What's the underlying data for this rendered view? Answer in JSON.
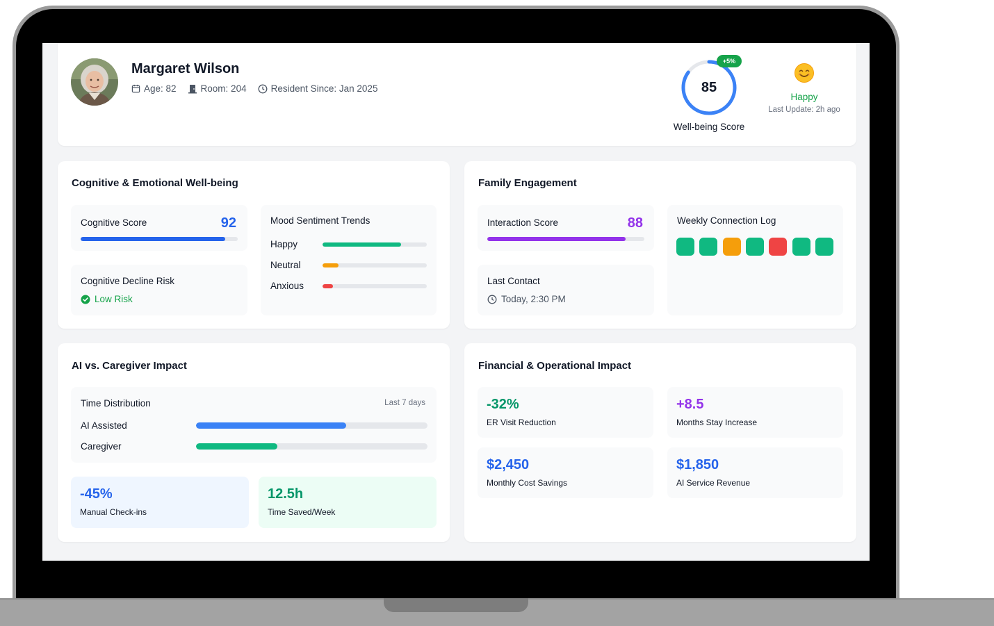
{
  "resident": {
    "name": "Margaret Wilson",
    "age": "Age: 82",
    "room": "Room: 204",
    "since": "Resident Since: Jan 2025"
  },
  "wellbeing": {
    "score": "85",
    "score_value": 85,
    "change_badge": "+5%",
    "label": "Well-being Score",
    "color": "#3b82f6"
  },
  "mood": {
    "emoji": "happy-face-icon",
    "label": "Happy",
    "last_update": "Last Update: 2h ago"
  },
  "cognitive": {
    "title": "Cognitive & Emotional Well-being",
    "score_label": "Cognitive Score",
    "score": "92",
    "score_value": 92,
    "risk_label": "Cognitive Decline Risk",
    "risk_value": "Low Risk",
    "mood_trends_title": "Mood Sentiment Trends",
    "mood_trends": [
      {
        "label": "Happy",
        "value": 75,
        "color": "#10b981"
      },
      {
        "label": "Neutral",
        "value": 15,
        "color": "#f59e0b"
      },
      {
        "label": "Anxious",
        "value": 10,
        "color": "#ef4444"
      }
    ]
  },
  "family": {
    "title": "Family Engagement",
    "interaction_label": "Interaction Score",
    "interaction_score": "88",
    "interaction_value": 88,
    "last_contact_label": "Last Contact",
    "last_contact_value": "Today, 2:30 PM",
    "weekly_log_title": "Weekly Connection Log",
    "weekly_log_colors": [
      "#10b981",
      "#10b981",
      "#f59e0b",
      "#10b981",
      "#ef4444",
      "#10b981",
      "#10b981"
    ]
  },
  "ai_impact": {
    "title": "AI vs. Caregiver Impact",
    "distribution_title": "Time Distribution",
    "period": "Last 7 days",
    "rows": [
      {
        "label": "AI Assisted",
        "value": 65,
        "color": "#3b82f6"
      },
      {
        "label": "Caregiver",
        "value": 35,
        "color": "#10b981"
      }
    ],
    "checkins_value": "-45%",
    "checkins_label": "Manual Check-ins",
    "saved_value": "12.5h",
    "saved_label": "Time Saved/Week"
  },
  "financial": {
    "title": "Financial & Operational Impact",
    "er_value": "-32%",
    "er_label": "ER Visit Reduction",
    "stay_value": "+8.5",
    "stay_label": "Months Stay Increase",
    "savings_value": "$2,450",
    "savings_label": "Monthly Cost Savings",
    "revenue_value": "$1,850",
    "revenue_label": "AI Service Revenue"
  }
}
